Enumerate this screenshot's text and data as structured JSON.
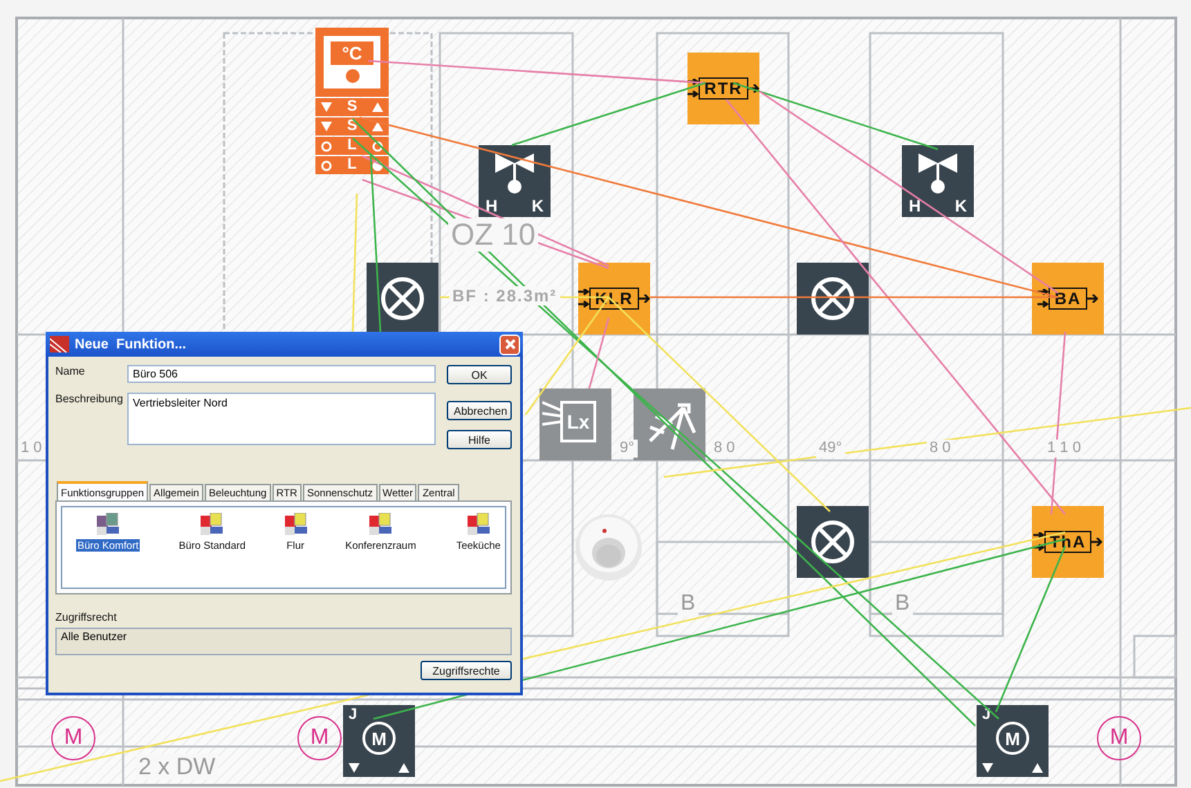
{
  "plan": {
    "labels": [
      "OZ 10",
      "BF : 28.3m²",
      "1 0",
      "9°",
      "8 0",
      "49°",
      "8 0",
      "1 1 0",
      "B",
      "B",
      "2 x DW"
    ]
  },
  "devices": [
    {
      "kind": "thermostat",
      "unit": "°C",
      "rows": [
        {
          "kind": "arrows",
          "letter": "S"
        },
        {
          "kind": "arrows",
          "letter": "S"
        },
        {
          "kind": "leds",
          "letter": "L",
          "on": false
        },
        {
          "kind": "leds",
          "letter": "L",
          "on": true
        }
      ]
    },
    {
      "kind": "block",
      "label": "RTR"
    },
    {
      "kind": "valve",
      "left": "H",
      "right": "K"
    },
    {
      "kind": "valve",
      "left": "H",
      "right": "K"
    },
    {
      "kind": "lamp"
    },
    {
      "kind": "block",
      "label": "KLR"
    },
    {
      "kind": "lamp"
    },
    {
      "kind": "block",
      "label": "BA"
    },
    {
      "kind": "lux",
      "label": "Lx"
    },
    {
      "kind": "sun"
    },
    {
      "kind": "picture"
    },
    {
      "kind": "lamp"
    },
    {
      "kind": "block",
      "label": "ThA"
    },
    {
      "kind": "marker",
      "label": "M"
    },
    {
      "kind": "marker",
      "label": "M"
    },
    {
      "kind": "motor",
      "corner": "J",
      "center": "M"
    },
    {
      "kind": "motor",
      "corner": "J",
      "center": "M"
    },
    {
      "kind": "marker",
      "label": "M"
    }
  ],
  "dialog": {
    "title": "Neue  Funktion...",
    "fields": [
      {
        "kind": "input",
        "label": "Name",
        "value": "Büro 506"
      },
      {
        "kind": "textarea",
        "label": "Beschreibung",
        "value": "Vertriebsleiter Nord"
      }
    ],
    "buttons": [
      "OK",
      "Abbrechen",
      "Hilfe"
    ],
    "tabs": [
      {
        "label": "Funktionsgruppen",
        "selected": true
      },
      {
        "label": "Allgemein",
        "selected": false
      },
      {
        "label": "Beleuchtung",
        "selected": false
      },
      {
        "label": "RTR",
        "selected": false
      },
      {
        "label": "Sonnenschutz",
        "selected": false
      },
      {
        "label": "Wetter",
        "selected": false
      },
      {
        "label": "Zentral",
        "selected": false
      }
    ],
    "groups": [
      {
        "label": "Büro Komfort",
        "selected": true
      },
      {
        "label": "Büro Standard",
        "selected": false
      },
      {
        "label": "Flur",
        "selected": false
      },
      {
        "label": "Konferenzraum",
        "selected": false
      },
      {
        "label": "Teeküche",
        "selected": false
      }
    ],
    "access": {
      "label": "Zugriffsrecht",
      "value": "Alle Benutzer",
      "button": "Zugriffsrechte"
    }
  }
}
